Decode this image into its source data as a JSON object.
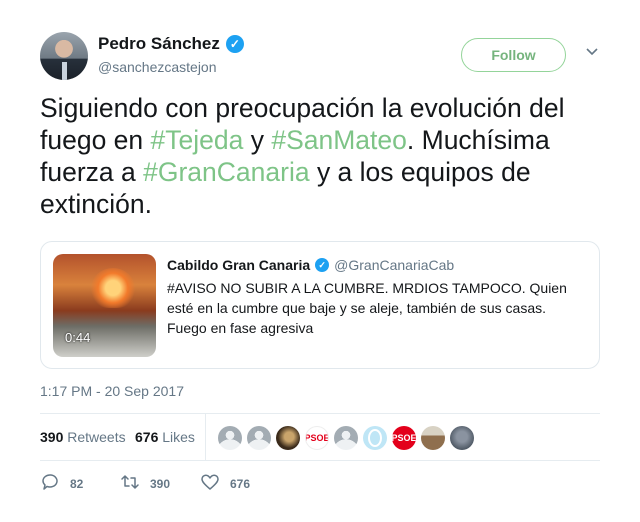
{
  "author": {
    "name": "Pedro Sánchez",
    "handle": "@sanchezcastejon",
    "verified_mark": "✓"
  },
  "follow_label": "Follow",
  "chevron": "⌄",
  "tweet": {
    "parts": [
      {
        "text": "Siguiendo con preocupación la evolución del fuego en ",
        "hashtag": false
      },
      {
        "text": "#Tejeda",
        "hashtag": true
      },
      {
        "text": " y ",
        "hashtag": false
      },
      {
        "text": "#SanMateo",
        "hashtag": true
      },
      {
        "text": ". Muchísima fuerza a ",
        "hashtag": false
      },
      {
        "text": "#GranCanaria",
        "hashtag": true
      },
      {
        "text": " y a los equipos de extinción.",
        "hashtag": false
      }
    ]
  },
  "quoted": {
    "name": "Cabildo Gran Canaria",
    "handle": "@GranCanariaCab",
    "verified_mark": "✓",
    "text": "#AVISO NO SUBIR A LA CUMBRE. MRDIOS TAMPOCO. Quien esté en la cumbre que baje y se aleje, también de sus casas. Fuego en fase agresiva",
    "video_duration": "0:44"
  },
  "timestamp": "1:17 PM - 20 Sep 2017",
  "stats": {
    "retweets_count": "390",
    "retweets_label": "Retweets",
    "likes_count": "676",
    "likes_label": "Likes"
  },
  "likers": [
    {
      "kind": "default",
      "text": ""
    },
    {
      "kind": "default",
      "text": ""
    },
    {
      "kind": "dark",
      "text": ""
    },
    {
      "kind": "psoe-white",
      "text": "PSOE"
    },
    {
      "kind": "default",
      "text": ""
    },
    {
      "kind": "ring",
      "text": ""
    },
    {
      "kind": "psoe-red",
      "text": "PSOE"
    },
    {
      "kind": "town",
      "text": ""
    },
    {
      "kind": "photo",
      "text": ""
    }
  ],
  "actions": {
    "reply_count": "82",
    "retweet_count": "390",
    "like_count": "676"
  },
  "colors": {
    "hashtag": "#7ec487",
    "follow_border": "#94d49a",
    "verified": "#1da1f2",
    "muted": "#657786"
  }
}
